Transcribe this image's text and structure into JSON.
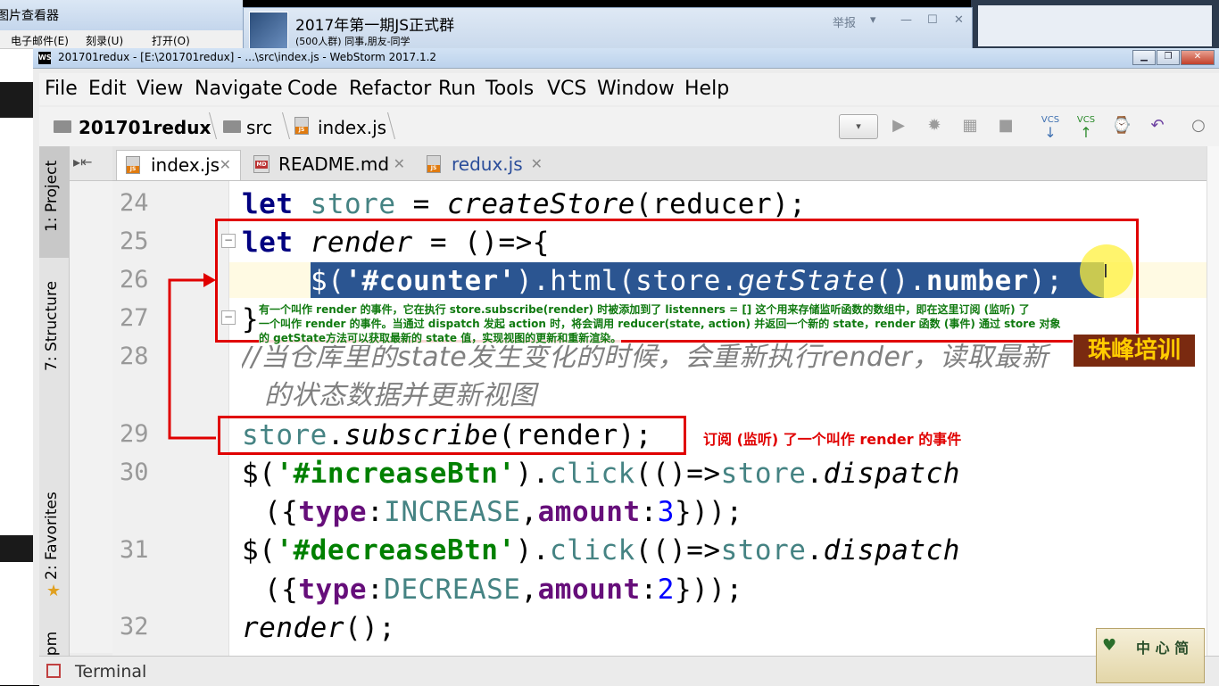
{
  "background": {
    "viewer_title": "图片查看器",
    "viewer_menu": [
      "电子邮件(E)",
      "刻录(U)",
      "打开(O)"
    ],
    "qq_window": {
      "title": "2017年第一期JS正式群",
      "subtitle": "(500人群) 同事,朋友-同学",
      "report": "举报"
    }
  },
  "window": {
    "title": "201701redux - [E:\\201701redux] - ...\\src\\index.js - WebStorm 2017.1.2",
    "logo": "WS"
  },
  "menu": [
    "File",
    "Edit",
    "View",
    "Navigate",
    "Code",
    "Refactor",
    "Run",
    "Tools",
    "VCS",
    "Window",
    "Help"
  ],
  "breadcrumb": {
    "project": "201701redux",
    "folder": "src",
    "file": "index.js"
  },
  "toolbar": {
    "vcs1": "VCS",
    "vcs2": "VCS"
  },
  "tool_windows": {
    "project": "1: Project",
    "structure": "7: Structure",
    "favorites": "2: Favorites",
    "npm": "npm"
  },
  "tabs": [
    {
      "label": "index.js",
      "active": true
    },
    {
      "label": "README.md",
      "active": false
    },
    {
      "label": "redux.js",
      "active": false
    }
  ],
  "line_numbers": [
    "24",
    "25",
    "26",
    "27",
    "28",
    "29",
    "30",
    "31",
    "32"
  ],
  "code": {
    "l24": {
      "kw": "let",
      "var": "store",
      "op": " = ",
      "fn": "createStore",
      "args": "(reducer);"
    },
    "l25": {
      "kw": "let",
      "fn": "render",
      "rest": " = ()=>{"
    },
    "l26": {
      "a": "$(",
      "str": "'#counter'",
      "b": ").html(store.",
      "fn": "getState",
      "c": "().",
      "prop": "number",
      "d": ");"
    },
    "l27": "}",
    "l28a": "//当仓库里的state发生变化的时候，会重新执行render，读取最新",
    "l28b": "的状态数据并更新视图",
    "l29": {
      "var": "store",
      "dot": ".",
      "fn": "subscribe",
      "args": "(render);"
    },
    "l30a": {
      "a": "$(",
      "str": "'#increaseBtn'",
      "b": ").",
      "call": "click",
      "c": "(()=>",
      "var": "store",
      "d": ".",
      "fn": "dispatch"
    },
    "l30b": {
      "a": "({",
      "p1": "type",
      "b": ":",
      "v1": "INCREASE",
      "c": ",",
      "p2": "amount",
      "d": ":",
      "n": "3",
      "e": "}));"
    },
    "l31a": {
      "a": "$(",
      "str": "'#decreaseBtn'",
      "b": ").",
      "call": "click",
      "c": "(()=>",
      "var": "store",
      "d": ".",
      "fn": "dispatch"
    },
    "l31b": {
      "a": "({",
      "p1": "type",
      "b": ":",
      "v1": "DECREASE",
      "c": ",",
      "p2": "amount",
      "d": ":",
      "n": "2",
      "e": "}));"
    },
    "l32": {
      "fn": "render",
      "rest": "();"
    }
  },
  "annotations": {
    "note_render_line1": "有一个叫作 render 的事件，它在执行 store.subscribe(render) 时被添加到了 listenners = [] 这个用来存储监听函数的数组中，即在这里订阅 (监听) 了",
    "note_render_line2": "一个叫作 render 的事件。当通过 dispatch 发起 action 时，将会调用 reducer(state, action) 并返回一个新的 state，render 函数 (事件) 通过 store 对象",
    "note_render_line3": "的 getState方法可以获取最新的 state 值，实现视图的更新和重新渲染。",
    "note_subscribe": "订阅 (监听) 了一个叫作 render 的事件",
    "brand": "珠峰培训"
  },
  "bottom": {
    "terminal": "Terminal",
    "corner_logo": "中 心 简"
  },
  "colors": {
    "keyword": "#000080",
    "string": "#008000",
    "property": "#660e7a",
    "number": "#0000ff",
    "selection": "#2b5591",
    "annotation_red": "#e00000"
  }
}
